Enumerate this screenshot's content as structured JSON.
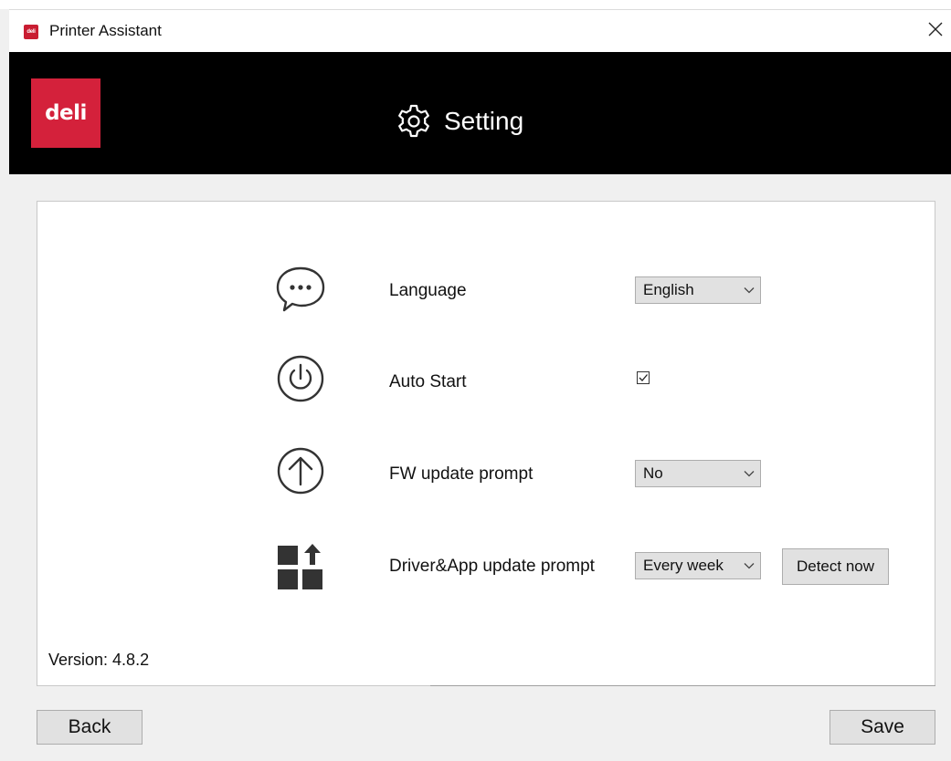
{
  "window": {
    "title": "Printer Assistant",
    "logo_text": "deli",
    "brand_color": "#d4213b"
  },
  "header": {
    "brand_text": "deli",
    "title": "Setting",
    "icon": "gear-icon"
  },
  "settings": {
    "language": {
      "label": "Language",
      "icon": "chat-bubble-icon",
      "selected": "English"
    },
    "auto_start": {
      "label": "Auto Start",
      "icon": "power-icon",
      "checked": true
    },
    "fw_update": {
      "label": "FW update prompt",
      "icon": "upload-arrow-icon",
      "selected": "No"
    },
    "driver_update": {
      "label": "Driver&App update prompt",
      "icon": "apps-update-icon",
      "selected": "Every week",
      "detect_label": "Detect now"
    }
  },
  "version": "Version: 4.8.2",
  "footer": {
    "back_label": "Back",
    "save_label": "Save"
  }
}
